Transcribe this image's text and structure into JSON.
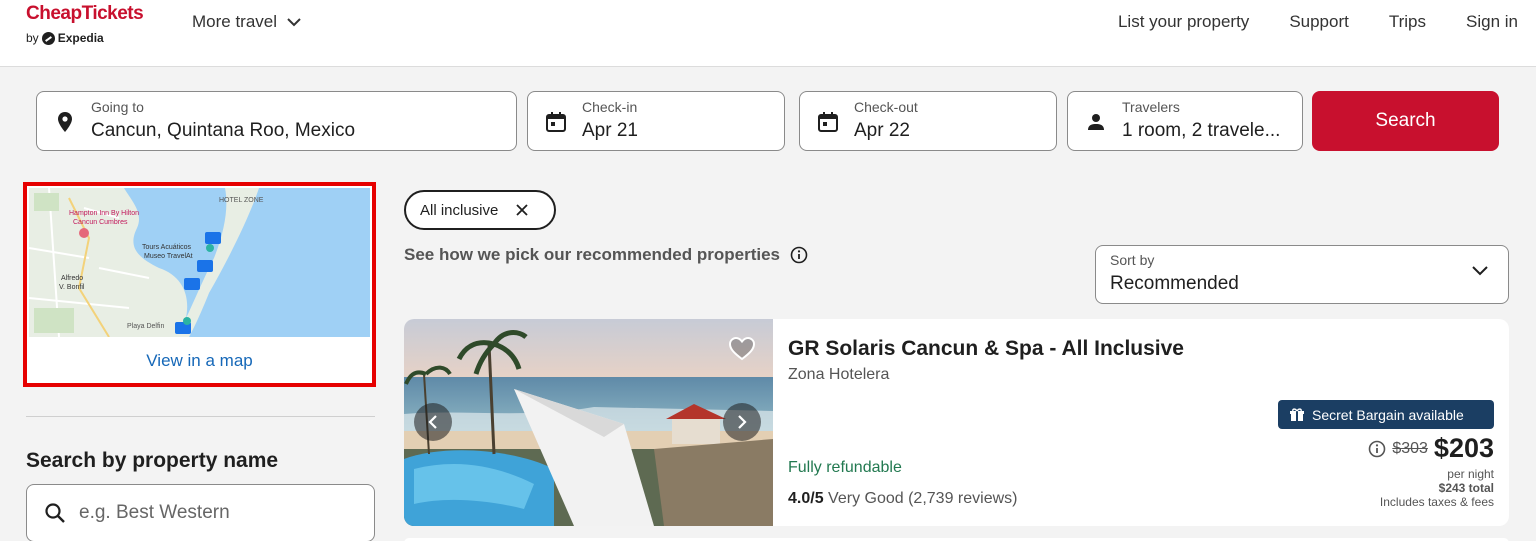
{
  "header": {
    "logo_main": "CheapTickets",
    "logo_by": "by",
    "logo_brand": "Expedia",
    "more_travel": "More travel",
    "nav": [
      "List your property",
      "Support",
      "Trips",
      "Sign in"
    ]
  },
  "search": {
    "going_to_label": "Going to",
    "going_to_value": "Cancun, Quintana Roo, Mexico",
    "checkin_label": "Check-in",
    "checkin_value": "Apr 21",
    "checkout_label": "Check-out",
    "checkout_value": "Apr 22",
    "travelers_label": "Travelers",
    "travelers_value": "1 room, 2 travele...",
    "search_button": "Search"
  },
  "map": {
    "link": "View in a map",
    "labels": {
      "hotel_zone": "HOTEL ZONE",
      "hampton_1": "Hampton Inn By Hilton",
      "hampton_2": "Cancun Cumbres",
      "tours_1": "Tours Acuáticos",
      "tours_2": "Museo TravelAt",
      "alfredo_1": "Alfredo",
      "alfredo_2": "V. Bonfil",
      "playa": "Playa Delfin"
    }
  },
  "property_search": {
    "title": "Search by property name",
    "placeholder": "e.g. Best Western"
  },
  "filters": {
    "chip": "All inclusive",
    "recommended_text": "See how we pick our recommended properties",
    "sort_label": "Sort by",
    "sort_value": "Recommended"
  },
  "listing": {
    "name": "GR Solaris Cancun & Spa - All Inclusive",
    "area": "Zona Hotelera",
    "refundable": "Fully refundable",
    "rating_score": "4.0/5",
    "rating_text": "Very Good (2,739 reviews)",
    "bargain": "Secret Bargain available",
    "old_price": "$303",
    "price": "$203",
    "per_night": "per night",
    "total": "$243 total",
    "taxes": "Includes taxes & fees"
  },
  "colors": {
    "brand": "#c8102e",
    "link": "#1668b8",
    "bargain_bg": "#1b3e63",
    "refund_green": "#227950",
    "highlight_border": "#e60000"
  }
}
